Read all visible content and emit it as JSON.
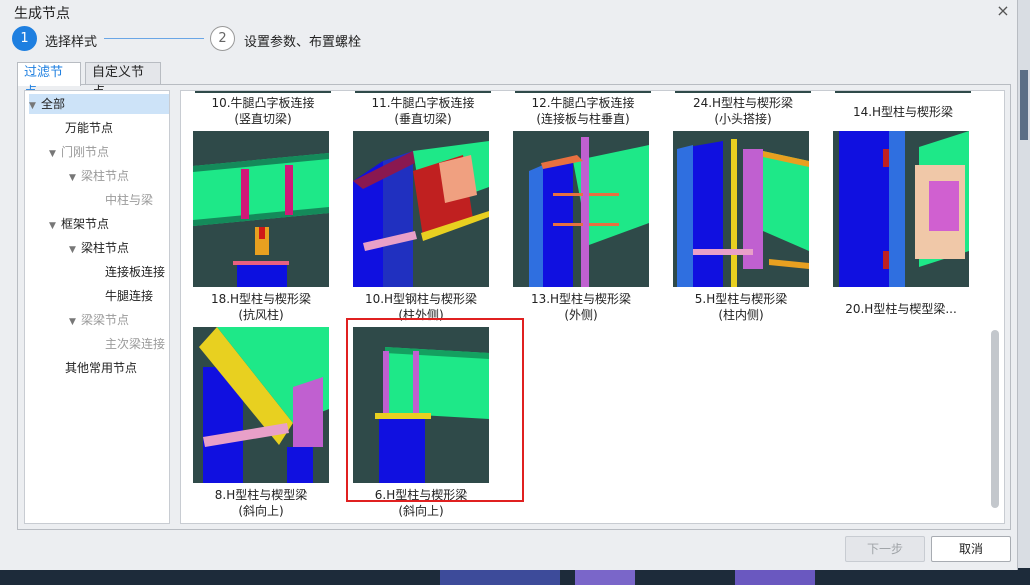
{
  "dialog": {
    "title": "生成节点",
    "close_icon": "×"
  },
  "steps": [
    {
      "number": "1",
      "label": "选择样式"
    },
    {
      "number": "2",
      "label": "设置参数、布置螺栓"
    }
  ],
  "tabs": [
    {
      "label": "过滤节点"
    },
    {
      "label": "自定义节点"
    }
  ],
  "tree": {
    "items": [
      {
        "label": "全部",
        "caret": "▼"
      },
      {
        "label": "万能节点",
        "caret": ""
      },
      {
        "label": "门刚节点",
        "caret": "▼"
      },
      {
        "label": "梁柱节点",
        "caret": "▼"
      },
      {
        "label": "中柱与梁",
        "caret": ""
      },
      {
        "label": "框架节点",
        "caret": "▼"
      },
      {
        "label": "梁柱节点",
        "caret": "▼"
      },
      {
        "label": "连接板连接",
        "caret": ""
      },
      {
        "label": "牛腿连接",
        "caret": ""
      },
      {
        "label": "梁梁节点",
        "caret": "▼"
      },
      {
        "label": "主次梁连接",
        "caret": ""
      },
      {
        "label": "其他常用节点",
        "caret": ""
      }
    ]
  },
  "gallery": {
    "top_row": [
      {
        "line1": "10.牛腿凸字板连接",
        "line2": "(竖直切梁)"
      },
      {
        "line1": "11.牛腿凸字板连接",
        "line2": "(垂直切梁)"
      },
      {
        "line1": "12.牛腿凸字板连接",
        "line2": "(连接板与柱垂直)"
      },
      {
        "line1": "24.H型柱与楔形梁",
        "line2": "(小头搭接)"
      },
      {
        "line1": "14.H型柱与楔形梁",
        "line2": ""
      }
    ],
    "row2": [
      {
        "line1": "18.H型柱与楔形梁",
        "line2": "(抗风柱)"
      },
      {
        "line1": "10.H型钢柱与楔形梁",
        "line2": "(柱外侧)"
      },
      {
        "line1": "13.H型柱与楔形梁",
        "line2": "(外侧)"
      },
      {
        "line1": "5.H型柱与楔形梁",
        "line2": "(柱内侧)"
      },
      {
        "line1": "20.H型柱与楔型梁...",
        "line2": ""
      }
    ],
    "row3": [
      {
        "line1": "8.H型柱与楔型梁",
        "line2": "(斜向上)"
      },
      {
        "line1": "6.H型柱与楔形梁",
        "line2": "(斜向上)"
      }
    ]
  },
  "buttons": {
    "next": "下一步",
    "cancel": "取消"
  },
  "colors": {
    "accent": "#1e7fe0",
    "highlight": "#e02020"
  }
}
